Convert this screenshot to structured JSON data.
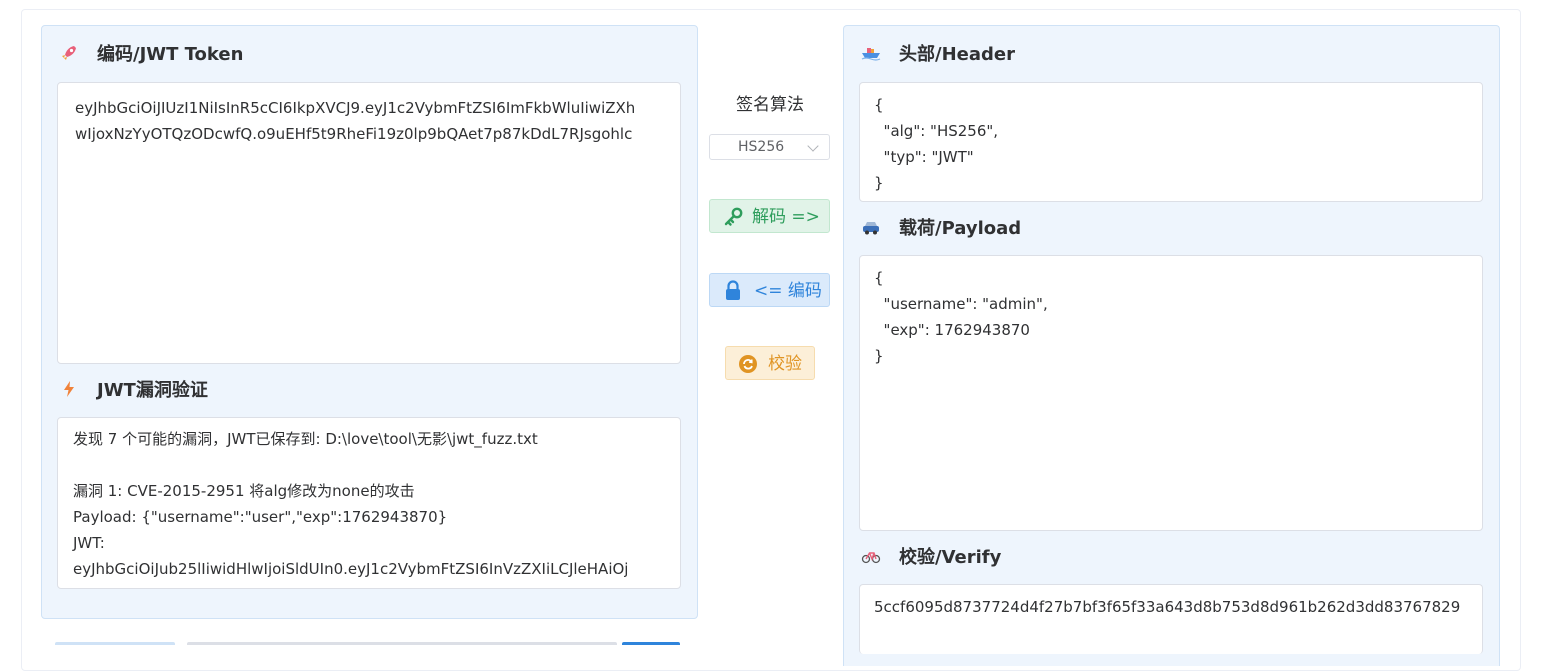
{
  "encode": {
    "title": "编码/JWT Token",
    "token": "eyJhbGciOiJIUzI1NiIsInR5cCI6IkpXVCJ9.eyJ1c2VybmFtZSI6ImFkbWluIiwiZXhwIjoxNzYyOTQzODcwfQ.o9uEHf5t9RheFi19z0lp9bQAet7p87kDdL7RJsgohlc"
  },
  "fuzz": {
    "title": "JWT漏洞验证",
    "output": "发现 7 个可能的漏洞，JWT已保存到: D:\\love\\tool\\无影\\jwt_fuzz.txt\n\n漏洞 1: CVE-2015-2951 将alg修改为none的攻击\nPayload: {\"username\":\"user\",\"exp\":1762943870}\nJWT:\neyJhbGciOiJub25lIiwidHlwIjoiSldUIn0.eyJ1c2VybmFtZSI6InVzZXIiLCJleHAiOj"
  },
  "middle": {
    "alg_label": "签名算法",
    "alg_value": "HS256",
    "decode_button": "解码 =>",
    "encode_button": "<= 编码",
    "verify_button": "校验"
  },
  "header": {
    "title": "头部/Header",
    "json": "{\n  \"alg\": \"HS256\",\n  \"typ\": \"JWT\"\n}"
  },
  "payload": {
    "title": "载荷/Payload",
    "json": "{\n  \"username\": \"admin\",\n  \"exp\": 1762943870\n}"
  },
  "verify": {
    "title": "校验/Verify",
    "value": "5ccf6095d8737724d4f27b7bf3f65f33a643d8b753d8d961b262d3dd83767829"
  },
  "colors": {
    "panel_bg": "#eef5fd",
    "decode": "#2e9d5c",
    "encode": "#2f84db",
    "verify": "#e09423"
  }
}
